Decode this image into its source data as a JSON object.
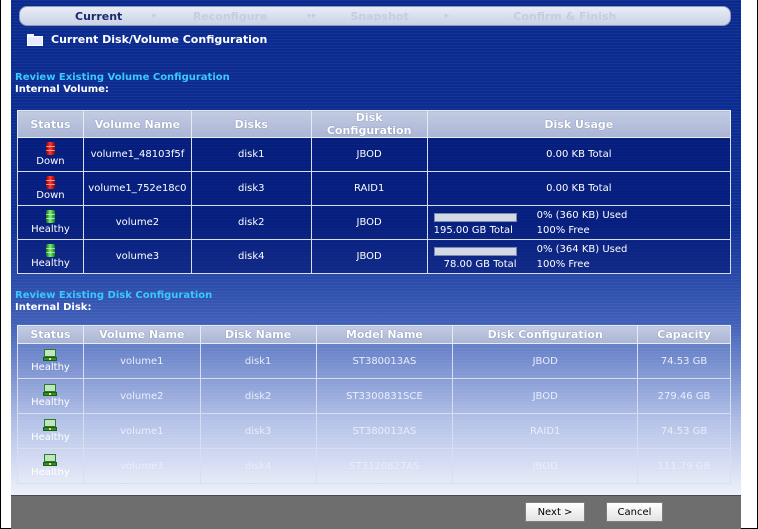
{
  "steps": [
    {
      "label": "Current"
    },
    {
      "label": "Reconfigure"
    },
    {
      "label": "Snapshot"
    },
    {
      "label": "Confirm & Finish"
    }
  ],
  "page_title": "Current Disk/Volume Configuration",
  "volume_section": {
    "title": "Review Existing Volume Configuration",
    "subtitle": "Internal Volume:",
    "headers": [
      "Status",
      "Volume Name",
      "Disks",
      "Disk Configuration",
      "Disk Usage"
    ],
    "rows": [
      {
        "status": "Down",
        "name": "volume1_48103f5f",
        "disks": "disk1",
        "config": "JBOD",
        "usage_total": "0.00 KB Total"
      },
      {
        "status": "Down",
        "name": "volume1_752e18c0",
        "disks": "disk3",
        "config": "RAID1",
        "usage_total": "0.00 KB Total"
      },
      {
        "status": "Healthy",
        "name": "volume2",
        "disks": "disk2",
        "config": "JBOD",
        "used_pct": 0,
        "used": "0% (360 KB) Used",
        "total": "195.00 GB Total",
        "free": "100% Free"
      },
      {
        "status": "Healthy",
        "name": "volume3",
        "disks": "disk4",
        "config": "JBOD",
        "used_pct": 0,
        "used": "0% (364 KB) Used",
        "total": "78.00 GB Total",
        "free": "100% Free"
      }
    ]
  },
  "disk_section": {
    "title": "Review Existing Disk Configuration",
    "subtitle": "Internal Disk:",
    "headers": [
      "Status",
      "Volume Name",
      "Disk Name",
      "Model Name",
      "Disk Configuration",
      "Capacity"
    ],
    "rows": [
      {
        "status": "Healthy",
        "volume": "volume1",
        "disk": "disk1",
        "model": "ST380013AS",
        "config": "JBOD",
        "capacity": "74.53 GB"
      },
      {
        "status": "Healthy",
        "volume": "volume2",
        "disk": "disk2",
        "model": "ST3300831SCE",
        "config": "JBOD",
        "capacity": "279.46 GB"
      },
      {
        "status": "Healthy",
        "volume": "volume1",
        "disk": "disk3",
        "model": "ST380013AS",
        "config": "RAID1",
        "capacity": "74.53 GB"
      },
      {
        "status": "Healthy",
        "volume": "volume3",
        "disk": "disk4",
        "model": "ST3120827AS",
        "config": "JBOD",
        "capacity": "111.79 GB"
      }
    ]
  },
  "buttons": {
    "next": "Next >",
    "cancel": "Cancel"
  },
  "colors": {
    "panel": "#0e2f96",
    "accent_title": "#38c9ff",
    "status_down": "#ff3b3b",
    "status_healthy": "#3fcf3f"
  }
}
